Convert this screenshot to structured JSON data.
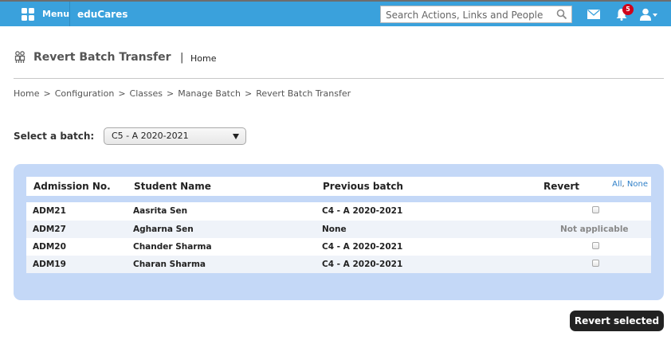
{
  "topbar": {
    "menu_label": "Menu",
    "app_name": "eduCares",
    "search_placeholder": "Search Actions, Links and People",
    "notification_count": "5",
    "icons": [
      "menu-grid-icon",
      "search-icon",
      "mail-icon",
      "bell-icon",
      "user-icon"
    ],
    "bar_color": "#3aa1dc"
  },
  "header": {
    "title": "Revert Batch Transfer",
    "separator": "|",
    "home_link": "Home",
    "icon": "users-icon"
  },
  "breadcrumb": [
    "Home",
    "Configuration",
    "Classes",
    "Manage Batch",
    "Revert Batch Transfer"
  ],
  "breadcrumb_separator": ">",
  "batch": {
    "label": "Select a batch:",
    "selected": "C5 - A 2020-2021"
  },
  "table": {
    "headers": {
      "admission": "Admission No.",
      "name": "Student Name",
      "previous": "Previous batch",
      "revert": "Revert"
    },
    "select_all": "All",
    "select_none": "None",
    "select_sep": ",",
    "rows": [
      {
        "admission": "ADM21",
        "name": "Aasrita Sen",
        "previous": "C4 - A 2020-2021",
        "revert": "checkbox"
      },
      {
        "admission": "ADM27",
        "name": "Agharna Sen",
        "previous": "None",
        "revert": "Not applicable"
      },
      {
        "admission": "ADM20",
        "name": "Chander Sharma",
        "previous": "C4 - A 2020-2021",
        "revert": "checkbox"
      },
      {
        "admission": "ADM19",
        "name": "Charan Sharma",
        "previous": "C4 - A 2020-2021",
        "revert": "checkbox"
      }
    ],
    "panel_color": "#c4d8f7"
  },
  "actions": {
    "revert_selected": "Revert selected"
  }
}
